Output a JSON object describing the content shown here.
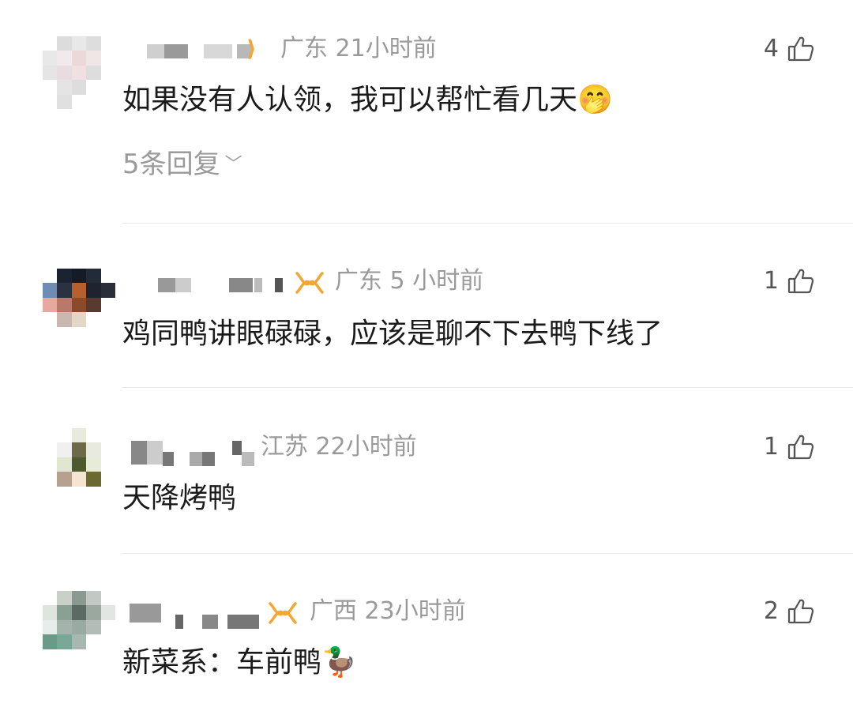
{
  "comments": [
    {
      "location": "广东",
      "time": "21小时前",
      "text": "如果没有人认领，我可以帮忙看几天",
      "emoji": "🤭",
      "likes": "4",
      "replies": "5条回复",
      "badge": "",
      "avatar_colors": [
        "#fff",
        "#dcdcdc",
        "#e8e8e8",
        "#dddddd",
        "#fff",
        "#e8e8e8",
        "#f2e9ec",
        "#ead9d9",
        "#f0e6e6",
        "#fff",
        "#e5e5e5",
        "#e8dce0",
        "#f0e0e2",
        "#ddd",
        "#fff",
        "#fff",
        "#e4e4e4",
        "#ddd",
        "#fff",
        "#fff",
        "#fff",
        "#e0e0e0",
        "#fff",
        "#fff",
        "#fff"
      ]
    },
    {
      "location": "广东",
      "time": "5 小时前",
      "text": "鸡同鸭讲眼碌碌，应该是聊不下去鸭下线了",
      "emoji": "",
      "likes": "1",
      "replies": "",
      "badge": "∞",
      "avatar_colors": [
        "#fff",
        "#1b2330",
        "#141a26",
        "#232b38",
        "#fff",
        "#6f8db4",
        "#2a3140",
        "#b5602e",
        "#1f2330",
        "#2a2e3a",
        "#e6a9a0",
        "#b9786a",
        "#8b4a2a",
        "#5a3a2e",
        "#fff",
        "#fff",
        "#c8b8b0",
        "#e3d8c8",
        "#fff",
        "#fff",
        "#fff",
        "#fff",
        "#fff",
        "#fff",
        "#fff"
      ]
    },
    {
      "location": "江苏",
      "time": "22小时前",
      "text": "天降烤鸭",
      "emoji": "",
      "likes": "1",
      "replies": "",
      "badge": "",
      "avatar_colors": [
        "#fff",
        "#fff",
        "#e8eadc",
        "#fff",
        "#fff",
        "#fff",
        "#f0f0f0",
        "#6d6a4a",
        "#e8eae0",
        "#fff",
        "#fff",
        "#e0e6d0",
        "#4e5a2e",
        "#e6ecd8",
        "#fff",
        "#fff",
        "#b8a090",
        "#f4e4d0",
        "#6a6a30",
        "#fff",
        "#fff",
        "#fff",
        "#fff",
        "#fff",
        "#fff"
      ]
    },
    {
      "location": "广西",
      "time": "23小时前",
      "text": "新菜系：车前鸭",
      "emoji": "🦆",
      "likes": "2",
      "replies": "",
      "badge": "∞",
      "avatar_colors": [
        "#fff",
        "#c8d0c8",
        "#8a9a90",
        "#c2c8c4",
        "#fff",
        "#dfe4de",
        "#8ba094",
        "#5c6a64",
        "#9aa8a0",
        "#e2e6e2",
        "#e8ecea",
        "#a4b4ac",
        "#9aaaa2",
        "#b4bcb8",
        "#fff",
        "#6a9a88",
        "#7aa898",
        "#a6b8b0",
        "#fff",
        "#fff",
        "#fff",
        "#fff",
        "#fff",
        "#fff",
        "#fff"
      ]
    }
  ]
}
